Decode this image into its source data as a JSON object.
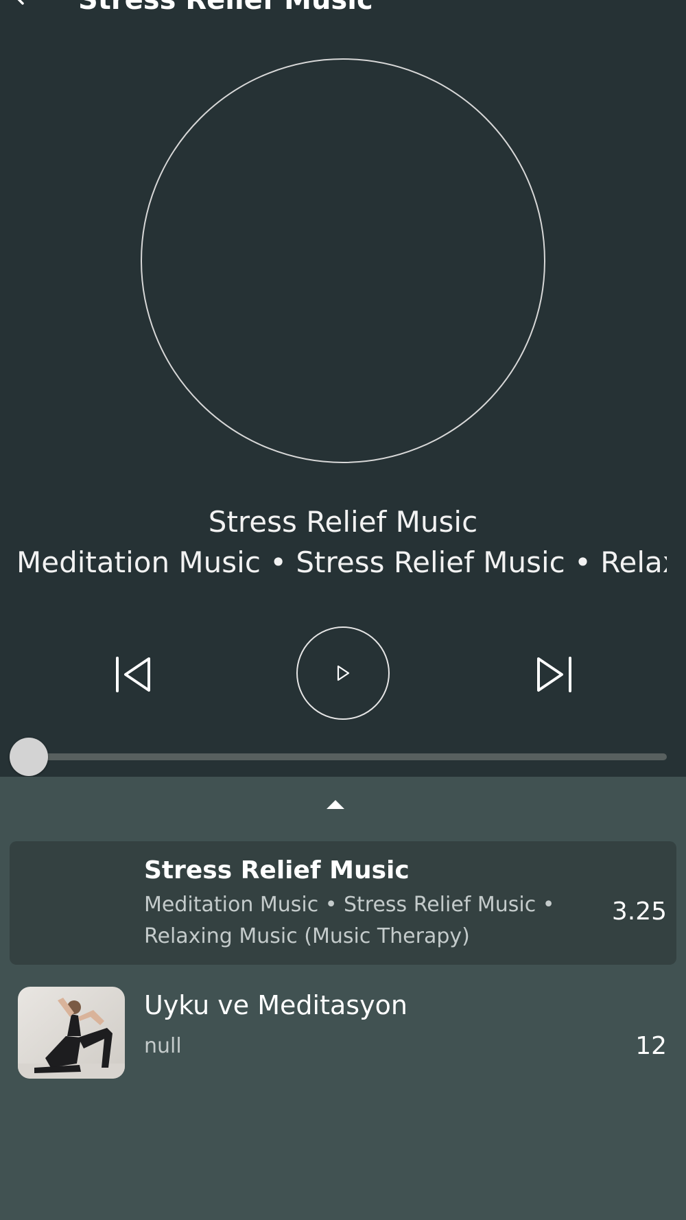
{
  "header": {
    "title": "Stress Relief Music",
    "back_icon": "arrow-left-icon"
  },
  "now_playing": {
    "title": "Stress Relief Music",
    "subtitle": "Meditation Music • Stress Relief Music • Relaxing Music (Music Therapy)"
  },
  "controls": {
    "prev_icon": "skip-previous-icon",
    "play_icon": "play-icon",
    "next_icon": "skip-next-icon"
  },
  "progress": {
    "fraction": 0.0
  },
  "queue": {
    "handle_icon": "chevron-up-icon",
    "items": [
      {
        "title": "Stress Relief Music",
        "subtitle": "Meditation Music • Stress Relief Music • Relaxing Music (Music Therapy)",
        "duration": "3.25",
        "active": true
      },
      {
        "title": "Uyku ve Meditasyon",
        "subtitle": "null",
        "duration": "12",
        "active": false,
        "thumbnail": "yoga-pose-photo"
      }
    ]
  },
  "colors": {
    "background": "#263235",
    "panel": "#415252",
    "active_item": "#344141",
    "accent": "#ffffff"
  }
}
